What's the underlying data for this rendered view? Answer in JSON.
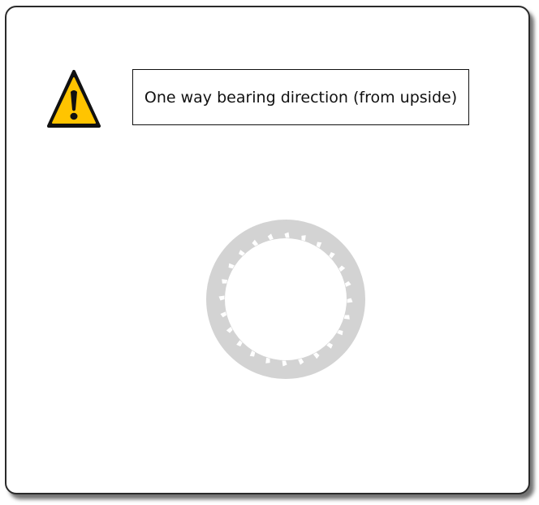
{
  "warning": {
    "icon": "warning-triangle-icon",
    "fill_color": "#FFC400",
    "outline_color": "#111111"
  },
  "caption": {
    "text": "One way bearing direction (from upside)"
  },
  "bearing": {
    "icon": "one-way-bearing-icon",
    "color": "#D3D3D3",
    "tooth_count": 24
  }
}
